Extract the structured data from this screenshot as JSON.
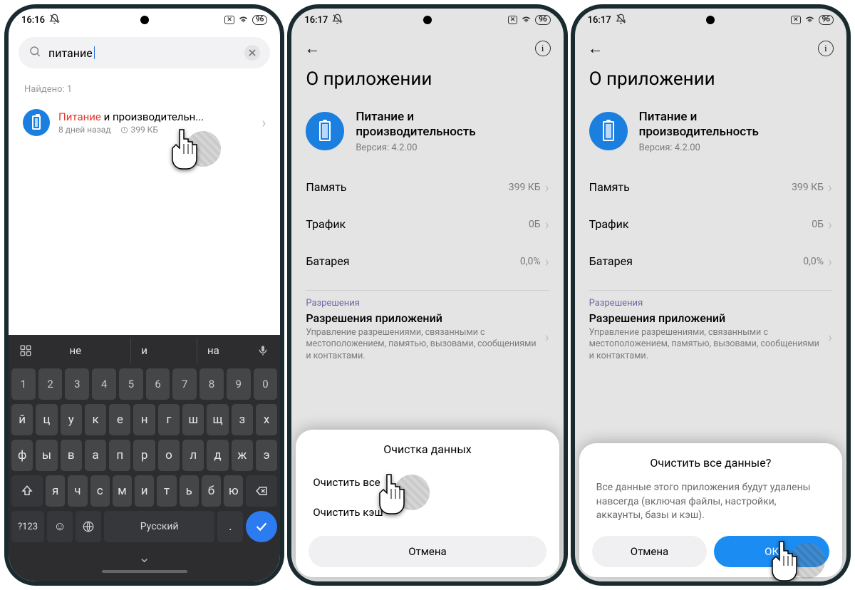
{
  "status": {
    "time1": "16:16",
    "time2": "16:17",
    "time3": "16:17",
    "battery": "96"
  },
  "screen1": {
    "search_query": "питание",
    "found_label": "Найдено: 1",
    "result_highlight": "Питание",
    "result_rest": " и производительн...",
    "result_sub_time": "8 дней назад",
    "result_sub_size": "399 КБ",
    "keyboard": {
      "sug1": "не",
      "sug2": "и",
      "sug3": "на",
      "row_num": [
        "1",
        "2",
        "3",
        "4",
        "5",
        "6",
        "7",
        "8",
        "9",
        "0"
      ],
      "row1": [
        "й",
        "ц",
        "у",
        "к",
        "е",
        "н",
        "г",
        "ш",
        "щ",
        "з",
        "х"
      ],
      "row2": [
        "ф",
        "ы",
        "в",
        "а",
        "п",
        "р",
        "о",
        "л",
        "д",
        "ж",
        "э"
      ],
      "row3": [
        "я",
        "ч",
        "с",
        "м",
        "и",
        "т",
        "ь",
        "б",
        "ю"
      ],
      "sym": "?123",
      "lang": "Русский"
    }
  },
  "details": {
    "page_title": "О приложении",
    "app_name_l1": "Питание и",
    "app_name_l2": "производительность",
    "version": "Версия: 4.2.00",
    "stat_mem_label": "Память",
    "stat_mem_val": "399 КБ",
    "stat_traf_label": "Трафик",
    "stat_traf_val": "0Б",
    "stat_bat_label": "Батарея",
    "stat_bat_val": "0,0%",
    "sec_label": "Разрешения",
    "perm_title": "Разрешения приложений",
    "perm_desc": "Управление разрешениями, связанными с местоположением, памятью, вызовами, сообщениями и контактами."
  },
  "sheet1": {
    "title": "Очистка данных",
    "opt1": "Очистить все",
    "opt2": "Очистить кэш",
    "cancel": "Отмена"
  },
  "sheet2": {
    "title": "Очистить все данные?",
    "desc": "Все данные этого приложения будут удалены навсегда (включая файлы, настройки, аккаунты, базы и кэш).",
    "cancel": "Отмена",
    "ok": "ОК"
  }
}
